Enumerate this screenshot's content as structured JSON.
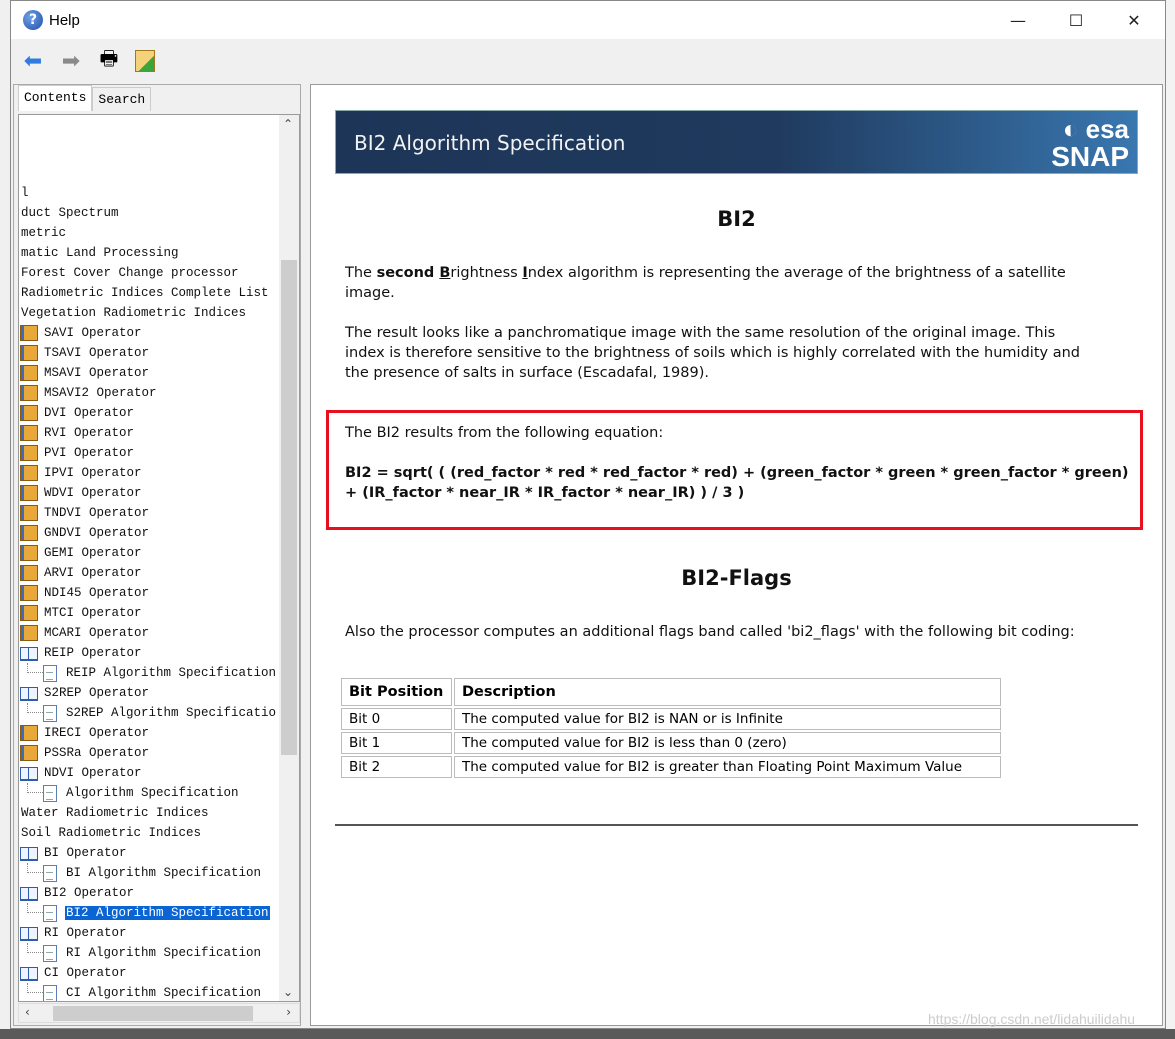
{
  "window": {
    "title": "Help",
    "minimize": "—",
    "maximize": "☐",
    "close": "✕"
  },
  "toolbar": {
    "back": "back-arrow",
    "forward": "forward-arrow",
    "print": "printer",
    "page_setup": "page-setup"
  },
  "tabs": [
    {
      "label": "Contents",
      "active": true
    },
    {
      "label": "Search",
      "active": false
    }
  ],
  "tree": [
    {
      "label": "--",
      "level": 0,
      "icon": "none"
    },
    {
      "label": "",
      "level": 0,
      "icon": "none"
    },
    {
      "label": "",
      "level": 0,
      "icon": "none"
    },
    {
      "label": "",
      "level": 0,
      "icon": "none"
    },
    {
      "label": "l",
      "level": 0,
      "icon": "none"
    },
    {
      "label": "duct Spectrum",
      "level": 0,
      "icon": "none"
    },
    {
      "label": "metric",
      "level": 0,
      "icon": "none"
    },
    {
      "label": "matic Land Processing",
      "level": 0,
      "icon": "none"
    },
    {
      "label": "Forest Cover Change processor",
      "level": 0,
      "icon": "none"
    },
    {
      "label": "Radiometric Indices Complete List",
      "level": 0,
      "icon": "none"
    },
    {
      "label": "Vegetation Radiometric Indices",
      "level": 0,
      "icon": "none"
    },
    {
      "label": "SAVI Operator",
      "level": 1,
      "icon": "book"
    },
    {
      "label": "TSAVI Operator",
      "level": 1,
      "icon": "book"
    },
    {
      "label": "MSAVI Operator",
      "level": 1,
      "icon": "book"
    },
    {
      "label": "MSAVI2 Operator",
      "level": 1,
      "icon": "book"
    },
    {
      "label": "DVI Operator",
      "level": 1,
      "icon": "book"
    },
    {
      "label": "RVI Operator",
      "level": 1,
      "icon": "book"
    },
    {
      "label": "PVI Operator",
      "level": 1,
      "icon": "book"
    },
    {
      "label": "IPVI Operator",
      "level": 1,
      "icon": "book"
    },
    {
      "label": "WDVI Operator",
      "level": 1,
      "icon": "book"
    },
    {
      "label": "TNDVI Operator",
      "level": 1,
      "icon": "book"
    },
    {
      "label": "GNDVI Operator",
      "level": 1,
      "icon": "book"
    },
    {
      "label": "GEMI Operator",
      "level": 1,
      "icon": "book"
    },
    {
      "label": "ARVI Operator",
      "level": 1,
      "icon": "book"
    },
    {
      "label": "NDI45 Operator",
      "level": 1,
      "icon": "book"
    },
    {
      "label": "MTCI Operator",
      "level": 1,
      "icon": "book"
    },
    {
      "label": "MCARI Operator",
      "level": 1,
      "icon": "book"
    },
    {
      "label": "REIP Operator",
      "level": 1,
      "icon": "open"
    },
    {
      "label": "REIP Algorithm Specification",
      "level": 2,
      "icon": "page"
    },
    {
      "label": "S2REP Operator",
      "level": 1,
      "icon": "open"
    },
    {
      "label": "S2REP Algorithm Specificatio",
      "level": 2,
      "icon": "page"
    },
    {
      "label": "IRECI Operator",
      "level": 1,
      "icon": "book"
    },
    {
      "label": "PSSRa Operator",
      "level": 1,
      "icon": "book"
    },
    {
      "label": "NDVI Operator",
      "level": 1,
      "icon": "open"
    },
    {
      "label": "Algorithm Specification",
      "level": 2,
      "icon": "page"
    },
    {
      "label": "Water Radiometric Indices",
      "level": 0,
      "icon": "none"
    },
    {
      "label": "Soil Radiometric Indices",
      "level": 0,
      "icon": "none"
    },
    {
      "label": "BI Operator",
      "level": 1,
      "icon": "open"
    },
    {
      "label": "BI Algorithm Specification",
      "level": 2,
      "icon": "page"
    },
    {
      "label": "BI2 Operator",
      "level": 1,
      "icon": "open"
    },
    {
      "label": "BI2 Algorithm Specification",
      "level": 2,
      "icon": "page",
      "selected": true
    },
    {
      "label": "RI Operator",
      "level": 1,
      "icon": "open"
    },
    {
      "label": "RI Algorithm Specification",
      "level": 2,
      "icon": "page"
    },
    {
      "label": "CI Operator",
      "level": 1,
      "icon": "open"
    },
    {
      "label": "CI Algorithm Specification",
      "level": 2,
      "icon": "page"
    }
  ],
  "content": {
    "banner_title": "BI2 Algorithm Specification",
    "logo": {
      "esa": "esa",
      "snap": "SNAP"
    },
    "heading": "BI2",
    "intro": {
      "pre": "The ",
      "b1": "second ",
      "u1": "B",
      "mid": "rightness ",
      "u2": "I",
      "post": "ndex algorithm is representing the average of the brightness of a satellite image."
    },
    "para2": "The result looks like a panchromatique image with the same resolution of the original image. This index is therefore sensitive to the brightness of soils which is highly correlated with the humidity and the presence of salts in surface (Escadafal, 1989).",
    "equation_intro": "The BI2 results from the following equation:",
    "equation": "BI2 = sqrt( ( (red_factor * red * red_factor * red) + (green_factor * green * green_factor * green) + (IR_factor * near_IR * IR_factor * near_IR) ) / 3 )",
    "flags_heading": "BI2-Flags",
    "flags_intro": "Also the processor computes an additional flags band called 'bi2_flags' with the following bit coding:",
    "table": {
      "headers": [
        "Bit Position",
        "Description"
      ],
      "rows": [
        [
          "Bit 0",
          "The computed value for BI2 is NAN or is Infinite"
        ],
        [
          "Bit 1",
          "The computed value for BI2 is less than 0 (zero)"
        ],
        [
          "Bit 2",
          "The computed value for BI2 is greater than Floating Point Maximum Value"
        ]
      ]
    }
  },
  "watermark": "https://blog.csdn.net/lidahuilidahu",
  "highlight_color": "#e8101e"
}
